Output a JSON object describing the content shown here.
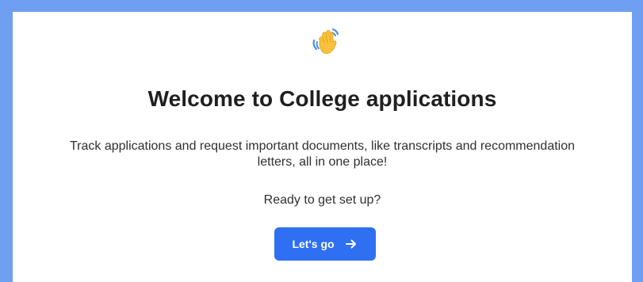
{
  "welcome": {
    "icon": "waving-hand-icon",
    "title": "Welcome to College applications",
    "description": "Track applications and request important documents, like transcripts and recommendation letters, all in one place!",
    "prompt": "Ready to get set up?",
    "cta_label": "Let's go",
    "cta_icon": "arrow-right-icon"
  },
  "colors": {
    "outer_background": "#6f9ff0",
    "panel_background": "#ffffff",
    "accent": "#2f6ff2",
    "title_text": "#1f1f1f",
    "body_text": "#2f2f2f"
  }
}
